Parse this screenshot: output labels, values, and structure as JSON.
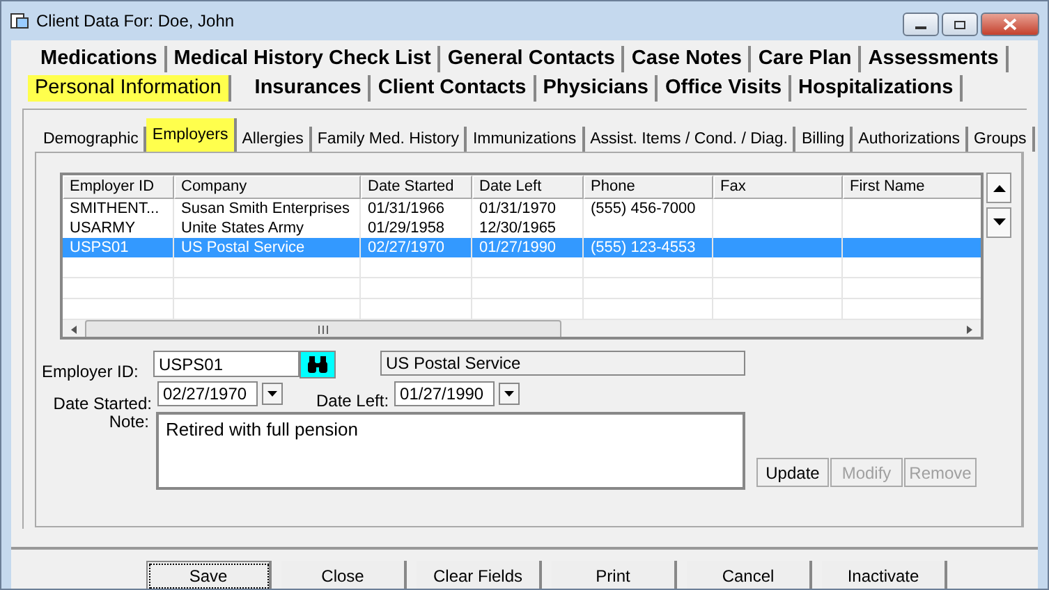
{
  "window": {
    "title": "Client Data For: Doe, John"
  },
  "main_tabs": [
    [
      {
        "label": "Medications",
        "selected": false
      },
      {
        "label": "Medical History Check List",
        "selected": false
      },
      {
        "label": "General Contacts",
        "selected": false
      },
      {
        "label": "Case Notes",
        "selected": false
      },
      {
        "label": "Care Plan",
        "selected": false
      },
      {
        "label": "Assessments",
        "selected": false
      }
    ],
    [
      {
        "label": "Personal Information",
        "selected": true
      },
      {
        "label": "Insurances",
        "selected": false
      },
      {
        "label": "Client Contacts",
        "selected": false
      },
      {
        "label": "Physicians",
        "selected": false
      },
      {
        "label": "Office Visits",
        "selected": false
      },
      {
        "label": "Hospitalizations",
        "selected": false
      }
    ]
  ],
  "sub_tabs": [
    {
      "label": "Demographic",
      "selected": false
    },
    {
      "label": "Employers",
      "selected": true
    },
    {
      "label": "Allergies",
      "selected": false
    },
    {
      "label": "Family Med. History",
      "selected": false
    },
    {
      "label": "Immunizations",
      "selected": false
    },
    {
      "label": "Assist. Items / Cond. / Diag.",
      "selected": false
    },
    {
      "label": "Billing",
      "selected": false
    },
    {
      "label": "Authorizations",
      "selected": false
    },
    {
      "label": "Groups",
      "selected": false
    }
  ],
  "table": {
    "columns": [
      "Employer ID",
      "Company",
      "Date Started",
      "Date Left",
      "Phone",
      "Fax",
      "First Name"
    ],
    "rows": [
      {
        "cells": [
          "SMITHENT...",
          "Susan Smith Enterprises",
          "01/31/1966",
          "01/31/1970",
          "(555) 456-7000",
          "",
          ""
        ],
        "selected": false
      },
      {
        "cells": [
          "USARMY",
          "Unite States Army",
          "01/29/1958",
          "12/30/1965",
          "",
          "",
          ""
        ],
        "selected": false
      },
      {
        "cells": [
          "USPS01",
          "US Postal Service",
          "02/27/1970",
          "01/27/1990",
          "(555) 123-4553",
          "",
          ""
        ],
        "selected": true
      }
    ]
  },
  "form": {
    "employer_id_label": "Employer ID:",
    "employer_id": "USPS01",
    "company": "US Postal Service",
    "date_started_label": "Date Started:",
    "date_started": "02/27/1970",
    "date_left_label": "Date Left:",
    "date_left": "01/27/1990",
    "note_label": "Note:",
    "note": "Retired with full pension"
  },
  "form_buttons": [
    {
      "label": "Update",
      "disabled": false
    },
    {
      "label": "Modify",
      "disabled": true
    },
    {
      "label": "Remove",
      "disabled": true
    }
  ],
  "buttons": [
    {
      "label": "Save",
      "focused": true
    },
    {
      "label": "Close",
      "focused": false
    },
    {
      "label": "Clear Fields",
      "focused": false
    },
    {
      "label": "Print",
      "focused": false
    },
    {
      "label": "Cancel",
      "focused": false
    },
    {
      "label": "Inactivate",
      "focused": false
    }
  ]
}
